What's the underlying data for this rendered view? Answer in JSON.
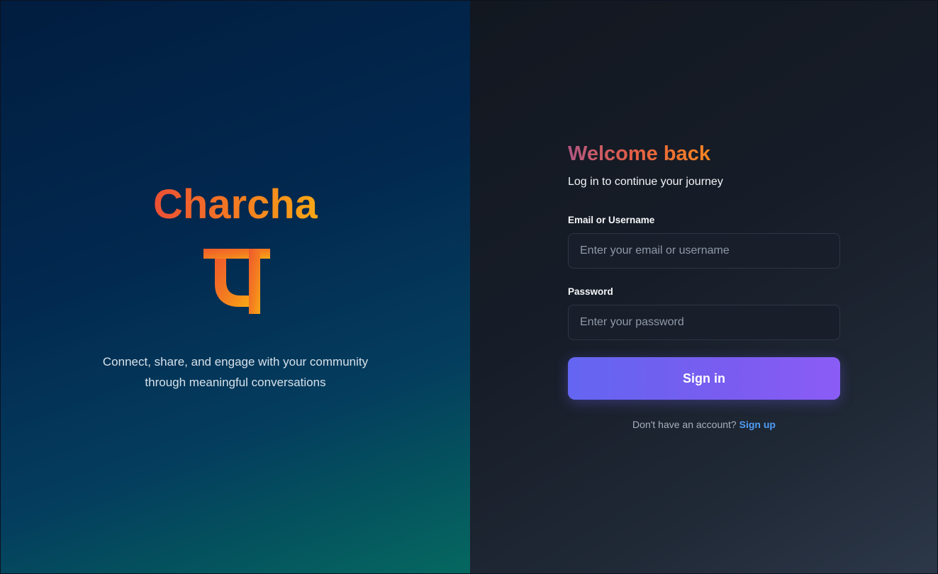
{
  "brand": {
    "name": "Charcha",
    "glyph": "च",
    "tagline_line1": "Connect, share, and engage with your community",
    "tagline_line2": "through meaningful conversations",
    "gradient_colors": [
      "#ec4f35",
      "#f47a22",
      "#f8a715"
    ]
  },
  "login": {
    "heading": "Welcome back",
    "subtitle": "Log in to continue your journey",
    "email_label": "Email or Username",
    "email_placeholder": "Enter your email or username",
    "email_value": "",
    "password_label": "Password",
    "password_placeholder": "Enter your password",
    "password_value": "",
    "submit_label": "Sign in",
    "signup_prompt": "Don't have an account?",
    "signup_link": "Sign up",
    "accent_color": "#6366f1",
    "link_color": "#4f9cf7"
  }
}
